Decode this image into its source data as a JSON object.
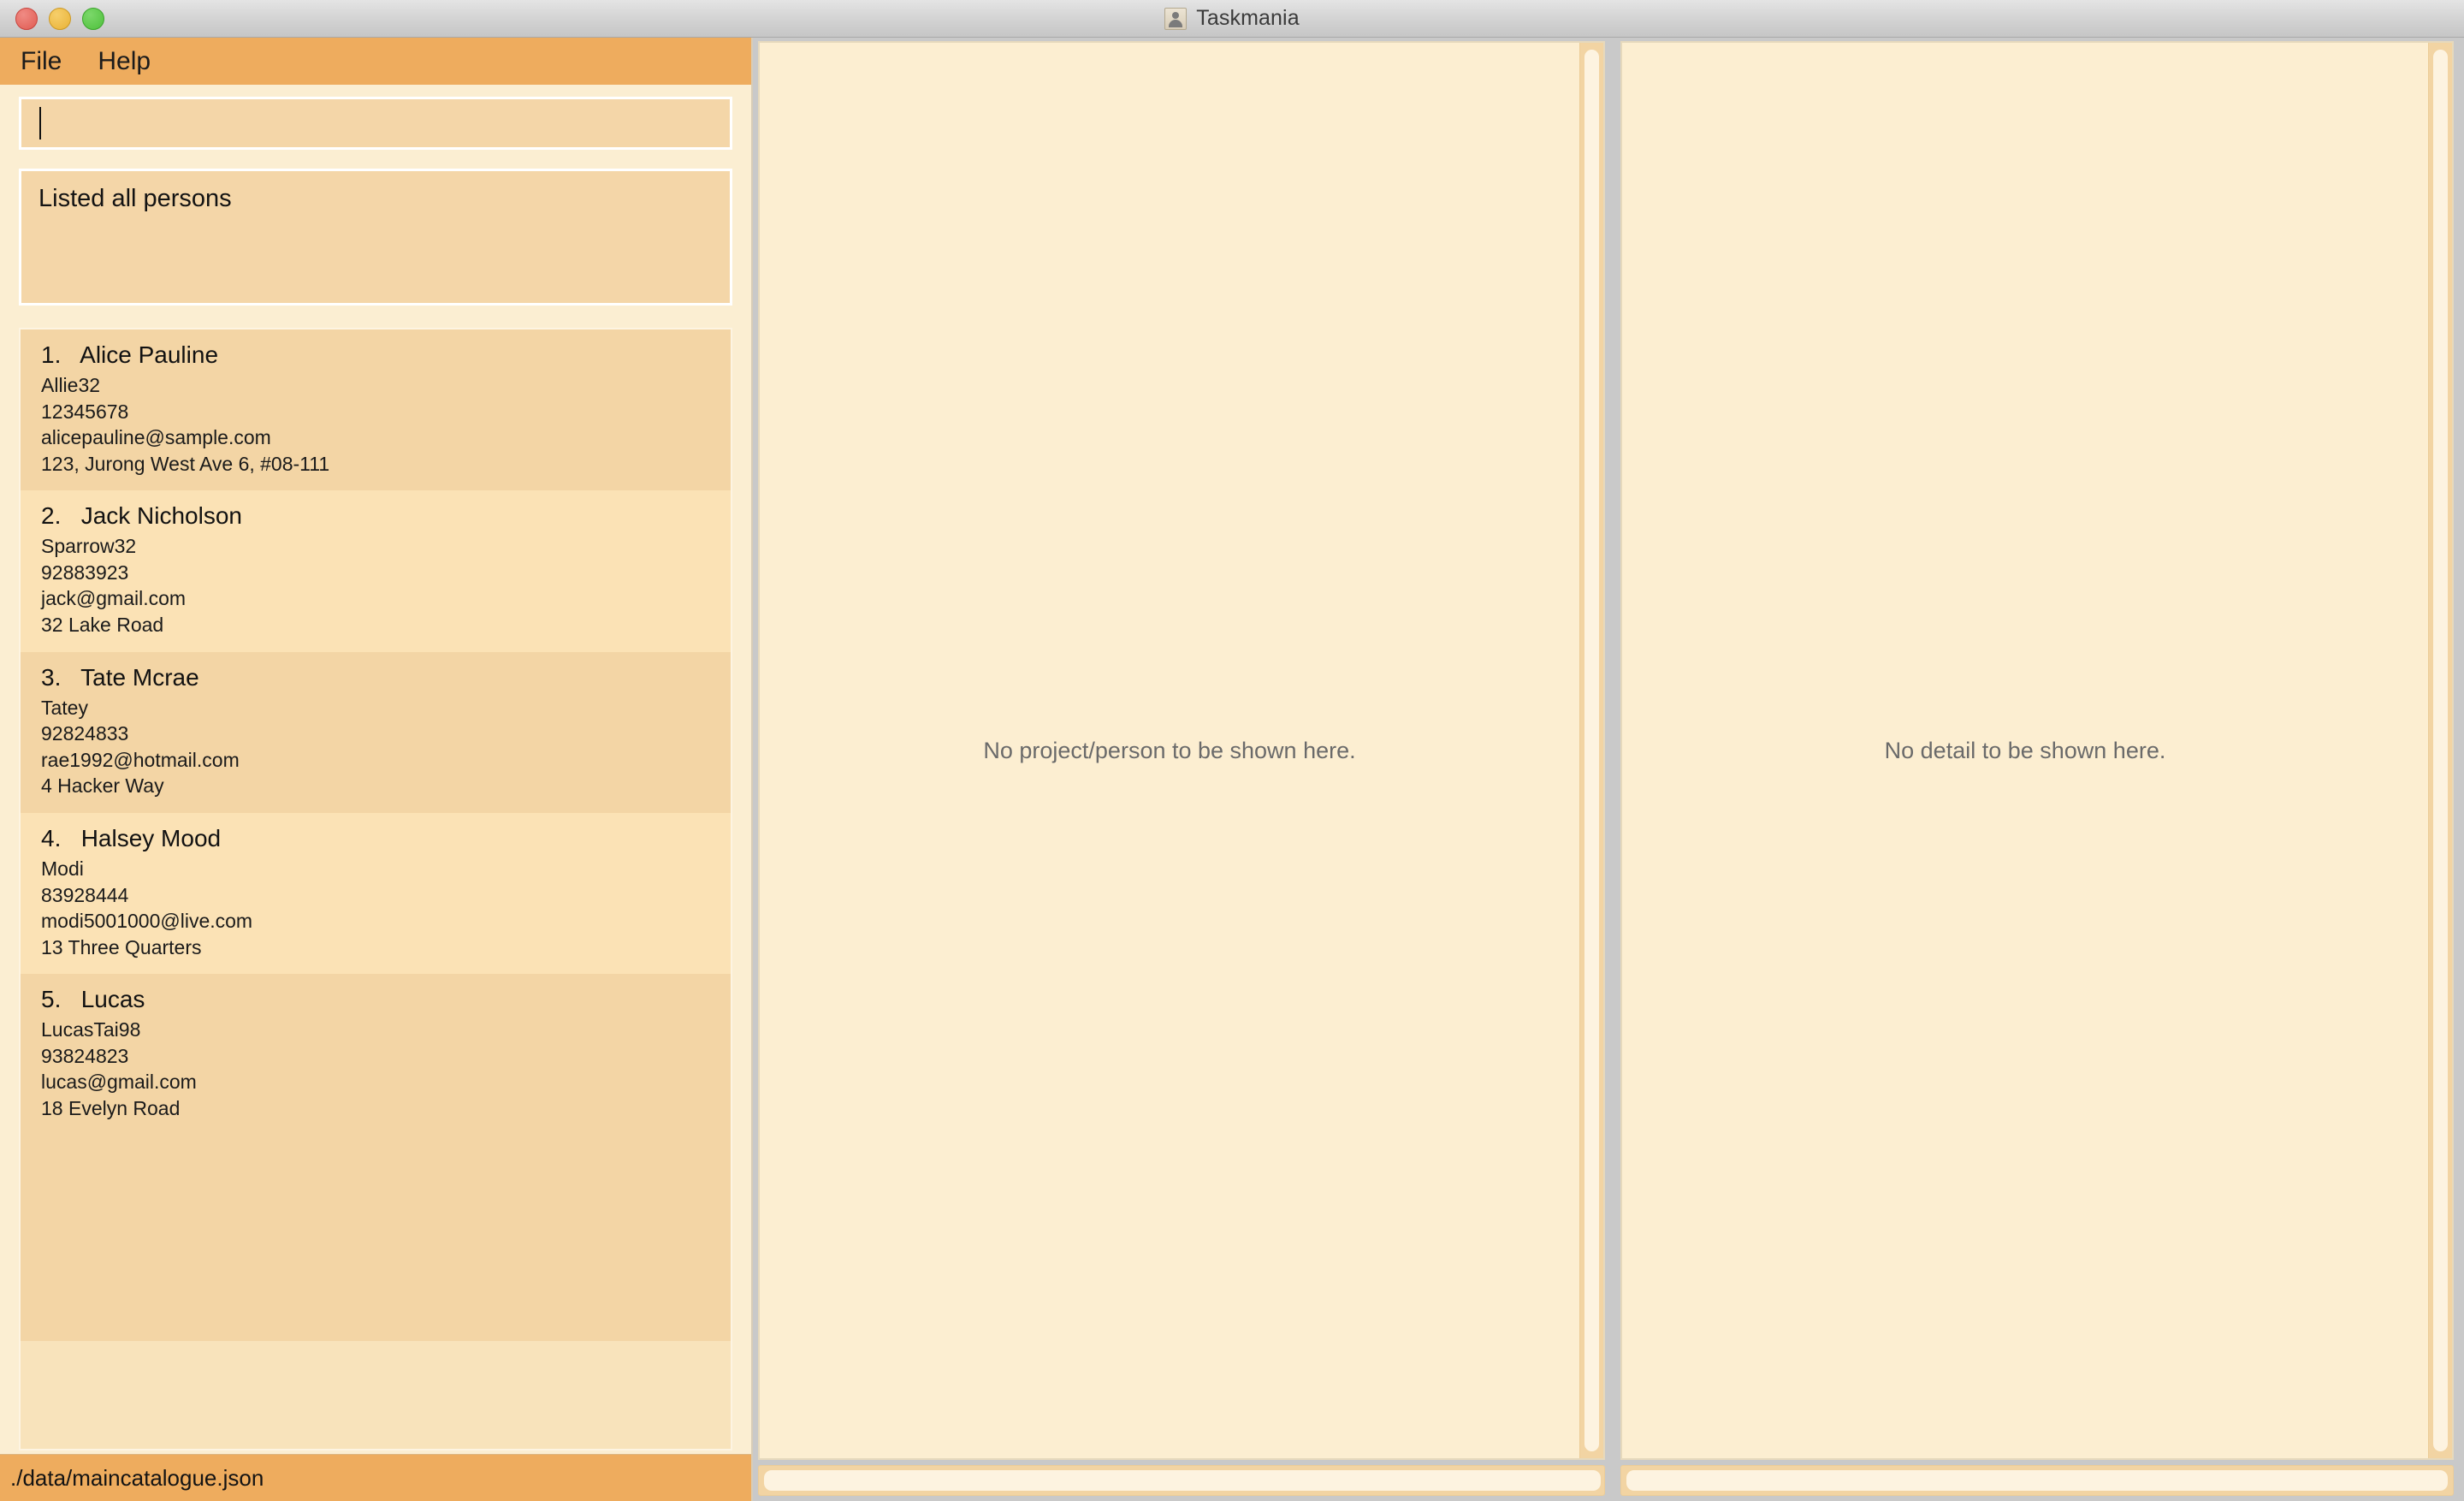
{
  "window": {
    "title": "Taskmania",
    "app_icon": "person-icon",
    "traffic_lights": {
      "close_label": "close-window",
      "minimize_label": "minimize-window",
      "zoom_label": "zoom-window"
    }
  },
  "colors": {
    "menubar_bg": "#eeac5e",
    "panel_bg": "#fceed1",
    "sidebar_bg": "#fbeed2",
    "card_odd_bg": "#f3d5a5",
    "card_even_bg": "#fbe2b5",
    "input_bg": "#f4d6a8",
    "placeholder_text": "#6a6a6a",
    "scrollbar_track": "#f2d4a3",
    "scrollbar_thumb": "#fdf3e0"
  },
  "menubar": {
    "items": [
      {
        "label": "File"
      },
      {
        "label": "Help"
      }
    ]
  },
  "command_box": {
    "value": "",
    "placeholder": "",
    "caret_visible": true
  },
  "result_display": {
    "message": "Listed all persons"
  },
  "person_list": {
    "items": [
      {
        "index": "1.",
        "name": "Alice Pauline",
        "title": "1.   Alice Pauline",
        "username": "Allie32",
        "phone": "12345678",
        "email": "alicepauline@sample.com",
        "address": "123, Jurong West Ave 6, #08-111"
      },
      {
        "index": "2.",
        "name": "Jack Nicholson",
        "title": "2.   Jack Nicholson",
        "username": "Sparrow32",
        "phone": "92883923",
        "email": "jack@gmail.com",
        "address": "32 Lake Road"
      },
      {
        "index": "3.",
        "name": "Tate Mcrae",
        "title": "3.   Tate Mcrae",
        "username": "Tatey",
        "phone": "92824833",
        "email": "rae1992@hotmail.com",
        "address": "4 Hacker Way"
      },
      {
        "index": "4.",
        "name": "Halsey Mood",
        "title": "4.   Halsey Mood",
        "username": "Modi",
        "phone": "83928444",
        "email": "modi5001000@live.com",
        "address": "13 Three Quarters"
      },
      {
        "index": "5.",
        "name": "Lucas",
        "title": "5.   Lucas",
        "username": "LucasTai98",
        "phone": "93824823",
        "email": "lucas@gmail.com",
        "address": "18 Evelyn Road"
      }
    ]
  },
  "center_panel": {
    "placeholder": "No project/person to be shown here."
  },
  "right_panel": {
    "placeholder": "No detail to be shown here."
  },
  "statusbar": {
    "file_path": "./data/maincatalogue.json"
  }
}
